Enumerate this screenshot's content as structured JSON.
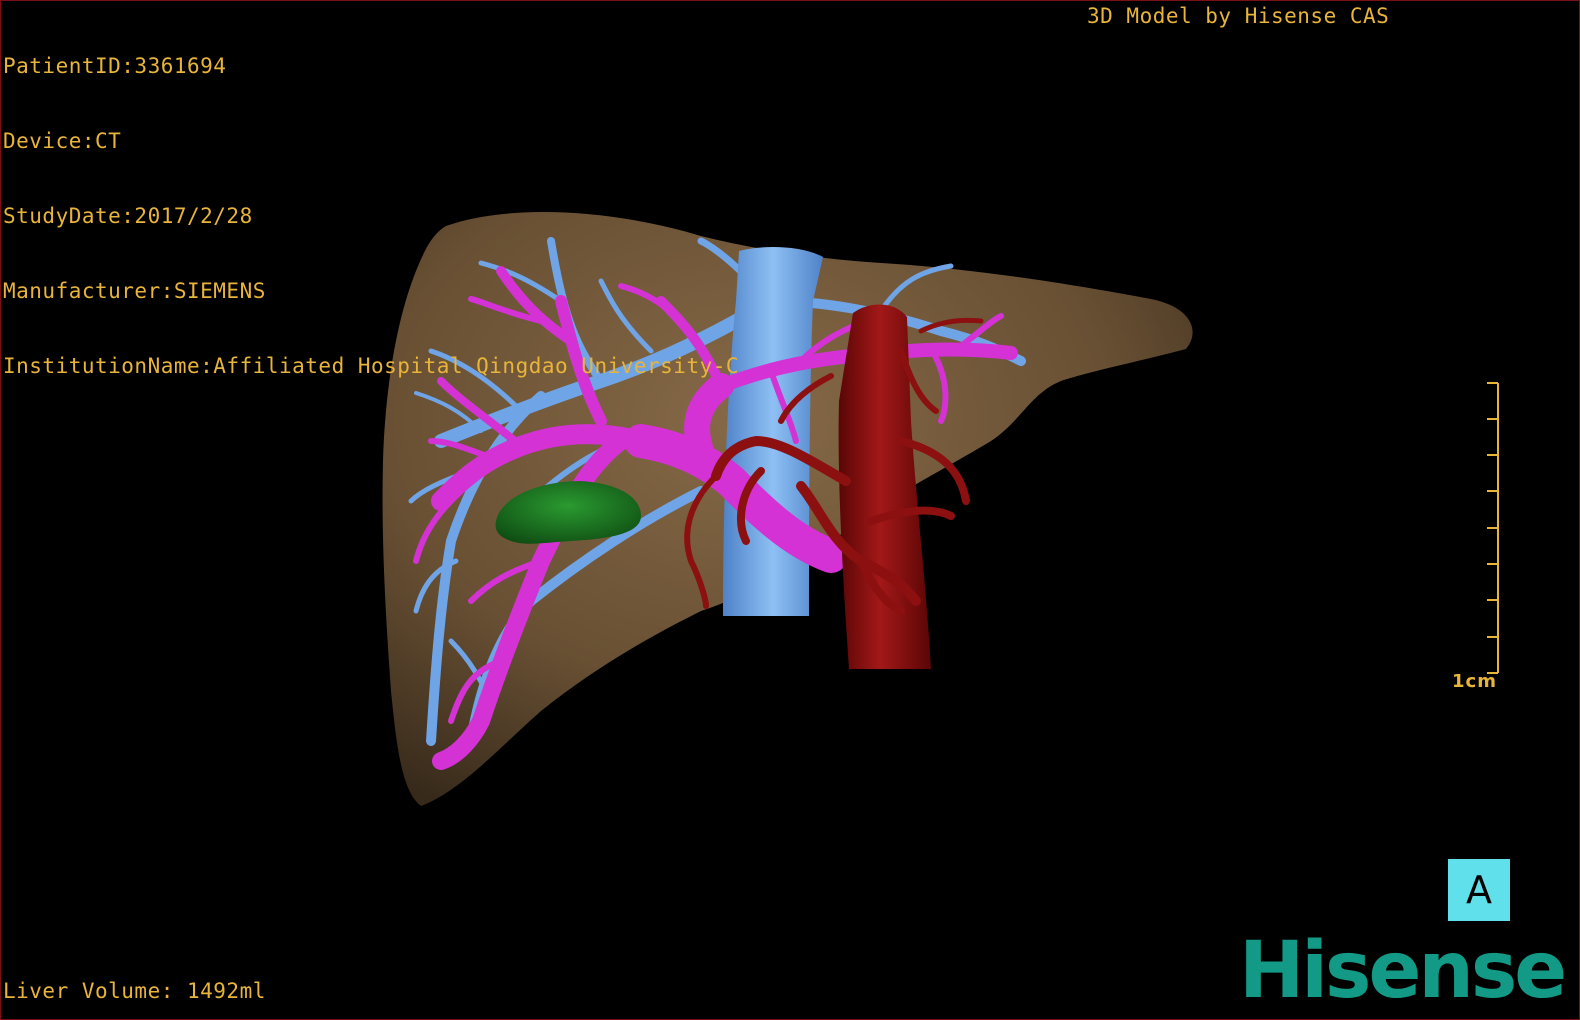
{
  "header": {
    "patient_id": "PatientID:3361694",
    "device": "Device:CT",
    "study_date": "StudyDate:2017/2/28",
    "manufacturer": "Manufacturer:SIEMENS",
    "institution": "InstitutionName:Affiliated Hospital Qingdao University-C",
    "model_credit": "3D Model by Hisense CAS"
  },
  "footer": {
    "liver_volume": "Liver Volume: 1492ml"
  },
  "scale_bar": {
    "label": "1cm",
    "tick_count": 8
  },
  "view": {
    "orientation_label": "A"
  },
  "brand": {
    "logo_text": "Hisense"
  },
  "colors": {
    "overlay_text": "#e8b43a",
    "liver": "#7a5e3e",
    "portal_vein": "#d432d4",
    "hepatic_vein_ivc": "#6fa4e6",
    "artery_aorta": "#8c1010",
    "gallbladder": "#1a7a24",
    "badge": "#5fe0ea",
    "brand": "#139a86",
    "border": "#7a0f14"
  }
}
